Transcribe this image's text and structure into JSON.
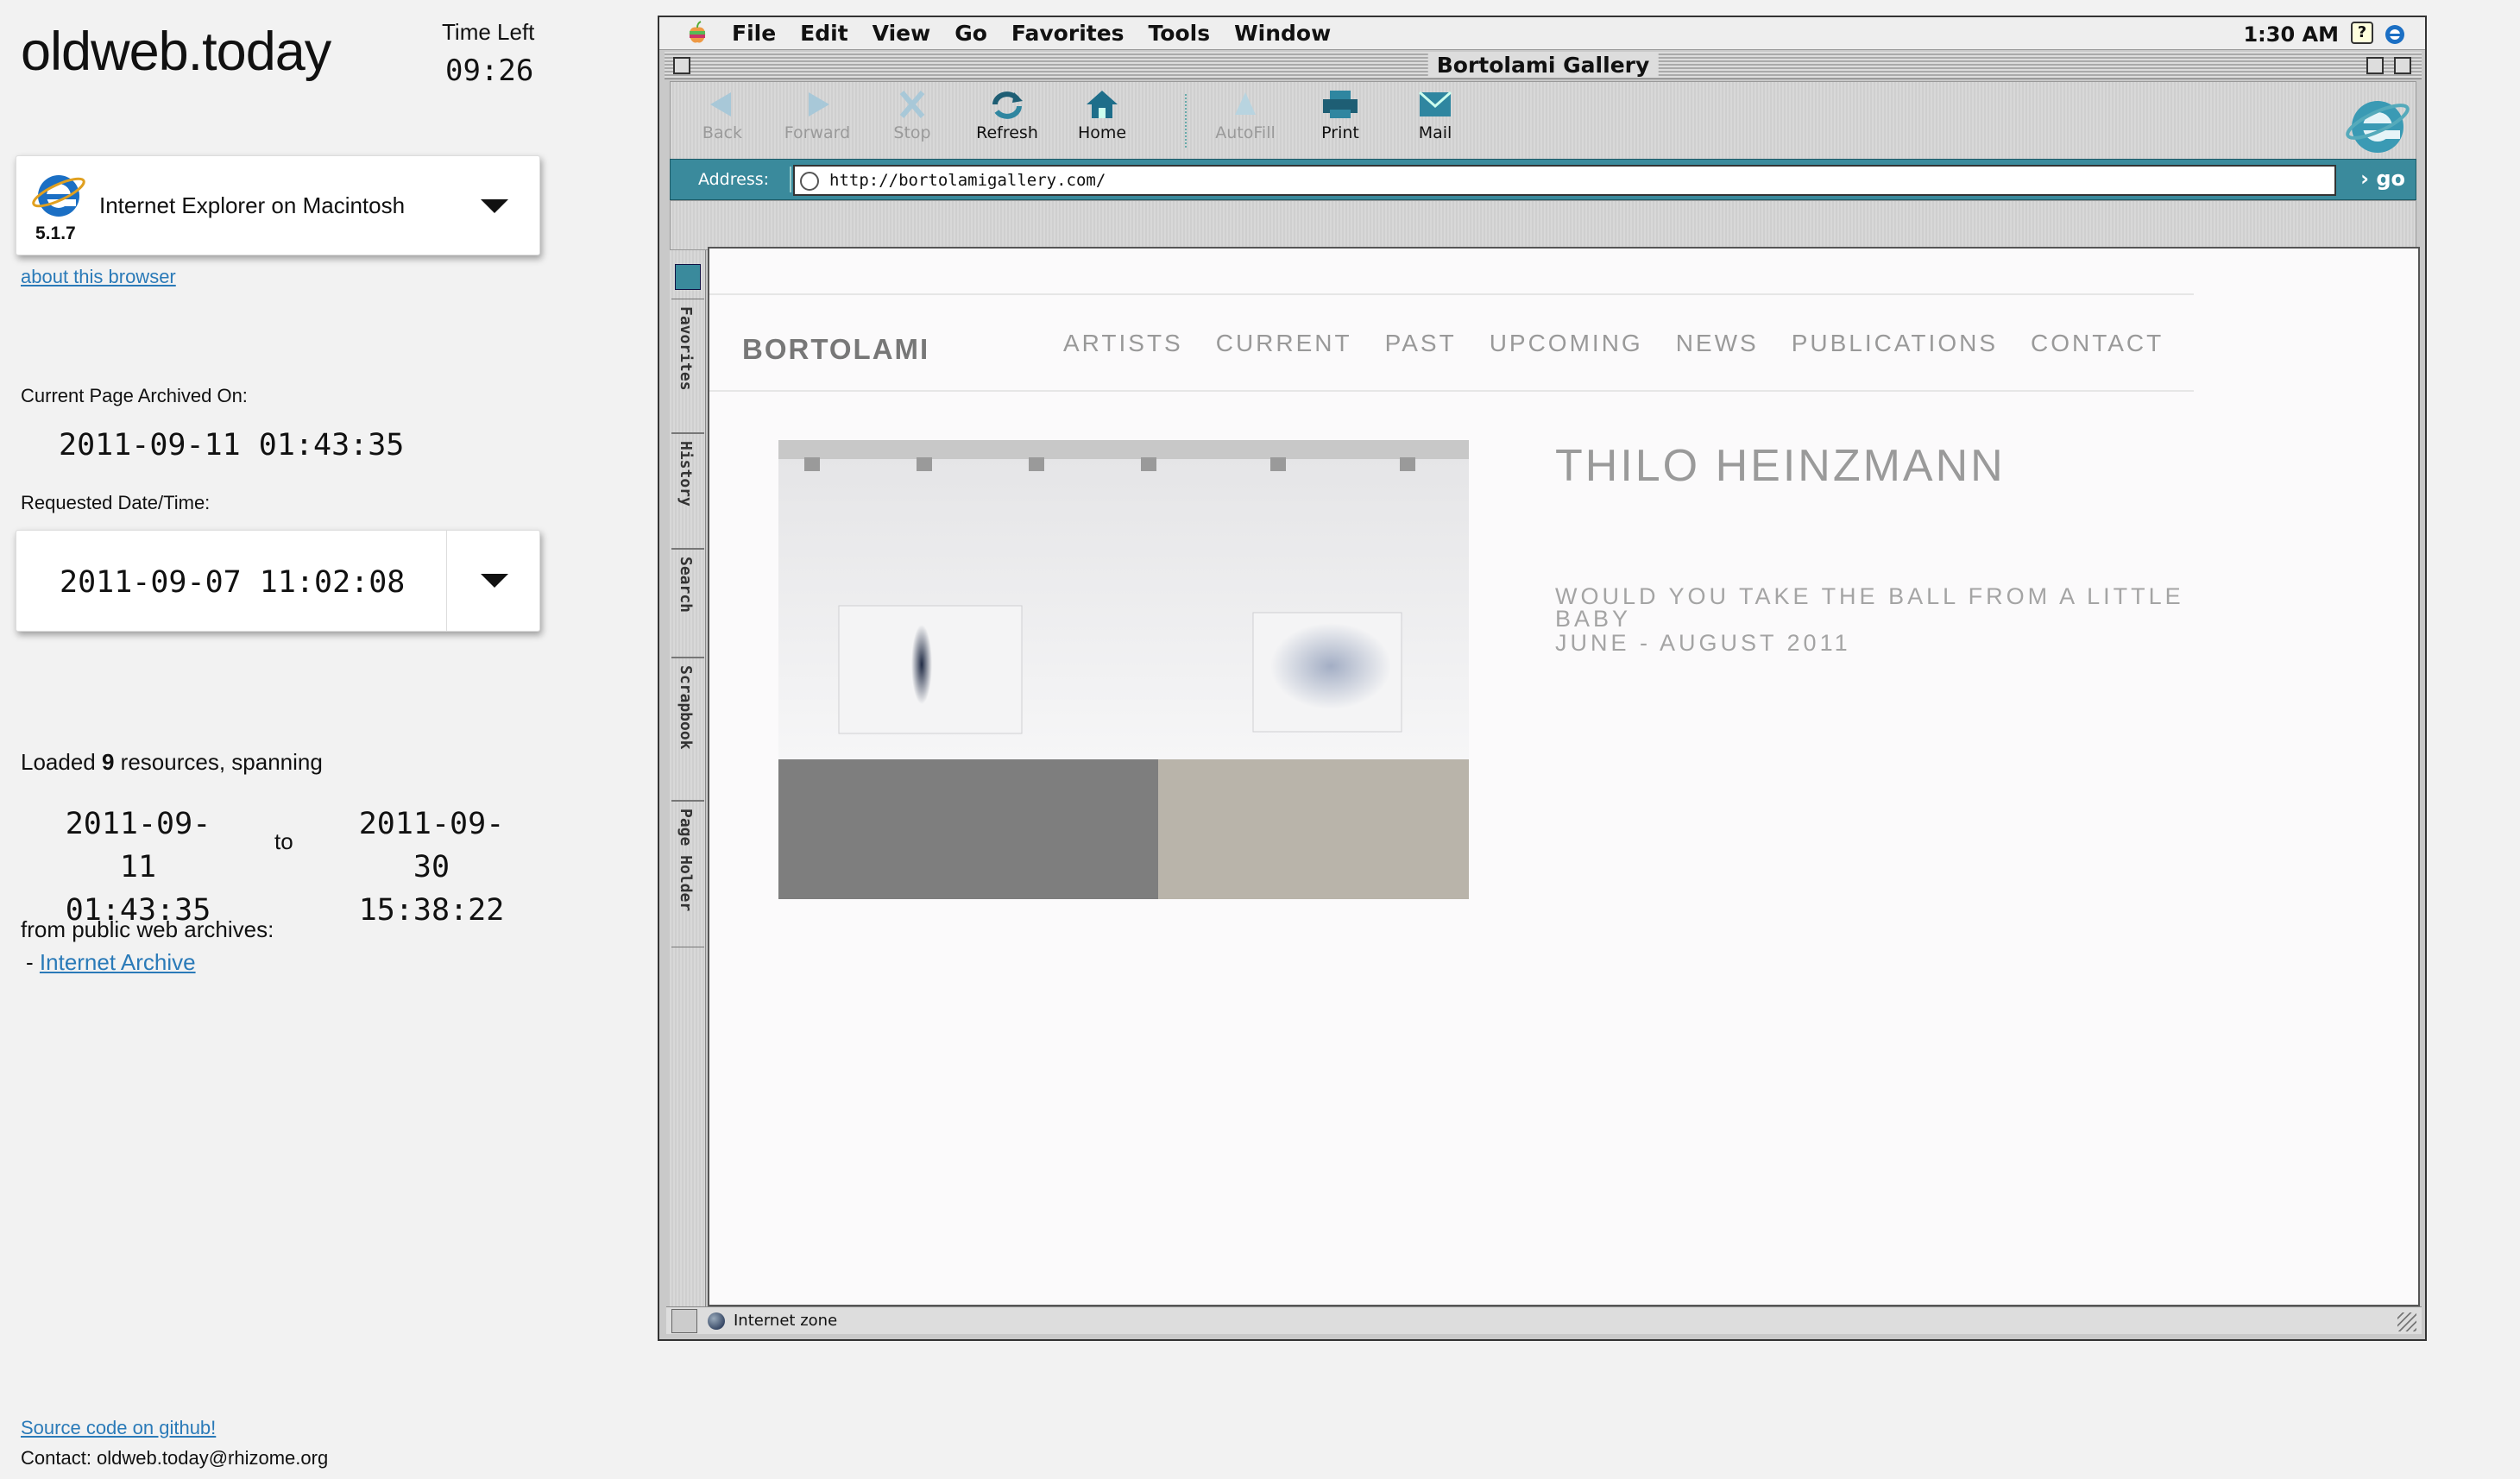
{
  "app": {
    "logo": "oldweb.today",
    "time_left_label": "Time Left",
    "time_left": "09:26"
  },
  "browser_select": {
    "name": "Internet Explorer on Macintosh",
    "version": "5.1.7",
    "about_link": "about this browser"
  },
  "archive_info": {
    "archived_label": "Current Page Archived On:",
    "archived_value": "2011-09-11 01:43:35",
    "requested_label": "Requested Date/Time:",
    "requested_value": "2011-09-07 11:02:08",
    "loaded_prefix": "Loaded ",
    "loaded_count": "9",
    "loaded_suffix": " resources, spanning",
    "span_from_date": "2011-09-11",
    "span_from_time": "01:43:35",
    "span_to_word": "to",
    "span_to_date": "2011-09-30",
    "span_to_time": "15:38:22",
    "from_public_label": "from public web archives:",
    "archive_bullet": "-",
    "archive_name": "Internet Archive"
  },
  "footer": {
    "source_link": "Source code on github!",
    "contact": "Contact: oldweb.today@rhizome.org"
  },
  "mac": {
    "menus": [
      "File",
      "Edit",
      "View",
      "Go",
      "Favorites",
      "Tools",
      "Window"
    ],
    "clock": "1:30 AM",
    "help_icon": "?",
    "window_title": "Bortolami Gallery",
    "toolbar": {
      "back": "Back",
      "forward": "Forward",
      "stop": "Stop",
      "refresh": "Refresh",
      "home": "Home",
      "autofill": "AutoFill",
      "print": "Print",
      "mail": "Mail"
    },
    "address_label": "Address:",
    "url": "http://bortolamigallery.com/",
    "go_label": "› go",
    "explorer_tabs": [
      "Favorites",
      "History",
      "Search",
      "Scrapbook",
      "Page Holder"
    ],
    "status": "Internet zone"
  },
  "site": {
    "logo": "BORTOLAMI",
    "nav": [
      "ARTISTS",
      "CURRENT",
      "PAST",
      "UPCOMING",
      "NEWS",
      "PUBLICATIONS",
      "CONTACT"
    ],
    "artist": "THILO HEINZMANN",
    "show_title": "WOULD YOU TAKE THE BALL FROM A LITTLE BABY",
    "show_dates": "JUNE - AUGUST 2011"
  },
  "colors": {
    "link": "#2a7ab8",
    "ie_teal": "#3a8a9c",
    "site_text": "#9a9a9a"
  }
}
